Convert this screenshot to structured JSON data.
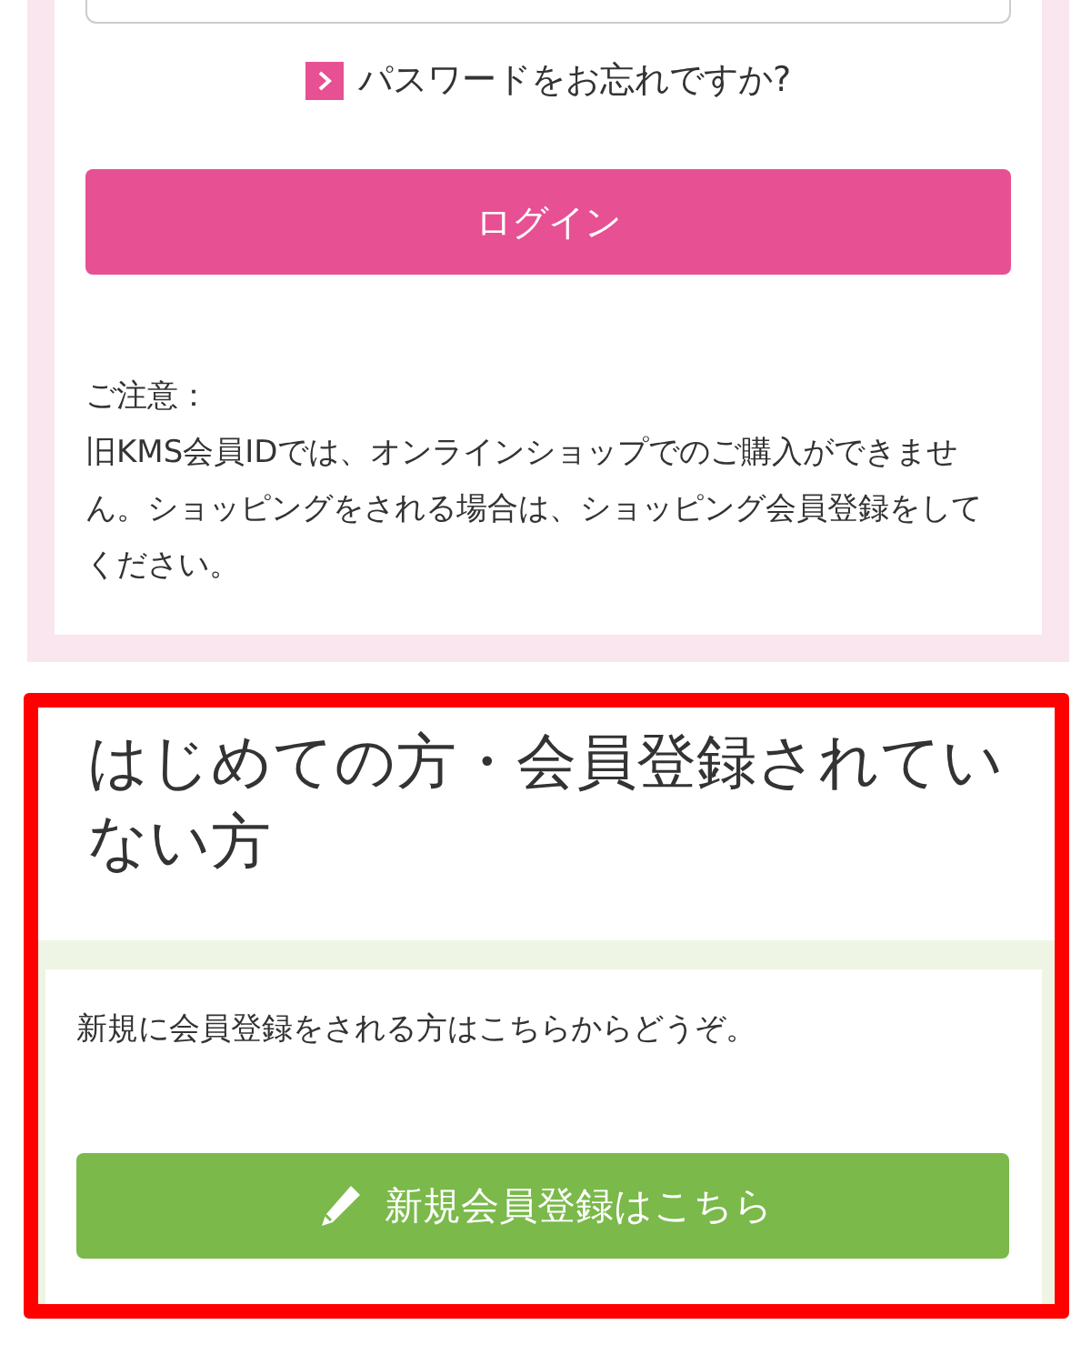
{
  "login_panel": {
    "forgot_password_link": "パスワードをお忘れですか?",
    "login_button": "ログイン",
    "notice_title": "ご注意：",
    "notice_text": "旧KMS会員IDでは、オンラインショップでのご購入ができません。ショッピングをされる場合は、ショッピング会員登録をしてください。"
  },
  "register_panel": {
    "highlighted": true,
    "heading": "はじめての方・会員登録されていない方",
    "description": "新規に会員登録をされる方はこちらからどうぞ。",
    "register_button": "新規会員登録はこちら"
  }
}
